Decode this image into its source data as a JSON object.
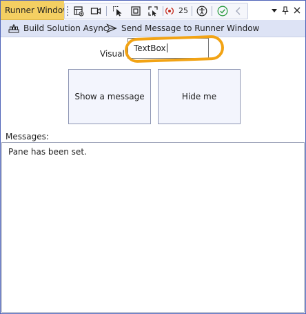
{
  "window": {
    "title": "Runner Window"
  },
  "toolbar": {
    "error_count": "25"
  },
  "commands": {
    "build_label": "Build Solution Async",
    "send_label": "Send Message to Runner Window"
  },
  "form": {
    "visual_label": "Visual S",
    "textbox_value": "TextBox",
    "show_button": "Show a message",
    "hide_button": "Hide me"
  },
  "messages": {
    "label": "Messages:",
    "text": "Pane has been set."
  },
  "colors": {
    "accent": "#f2a314",
    "title_tab": "#f4cf62",
    "frame_border": "#4e63b8",
    "command_bar": "#dde3f5",
    "ok_green": "#2f9e44",
    "error_red": "#c42b1c"
  },
  "icons": [
    "select-element-icon",
    "video-icon",
    "pointer-icon",
    "frame-icon",
    "refresh-selection-icon",
    "error-badge-icon",
    "accessibility-icon",
    "check-icon",
    "back-icon",
    "dropdown-icon",
    "pin-icon",
    "close-icon",
    "build-icon",
    "send-icon"
  ]
}
